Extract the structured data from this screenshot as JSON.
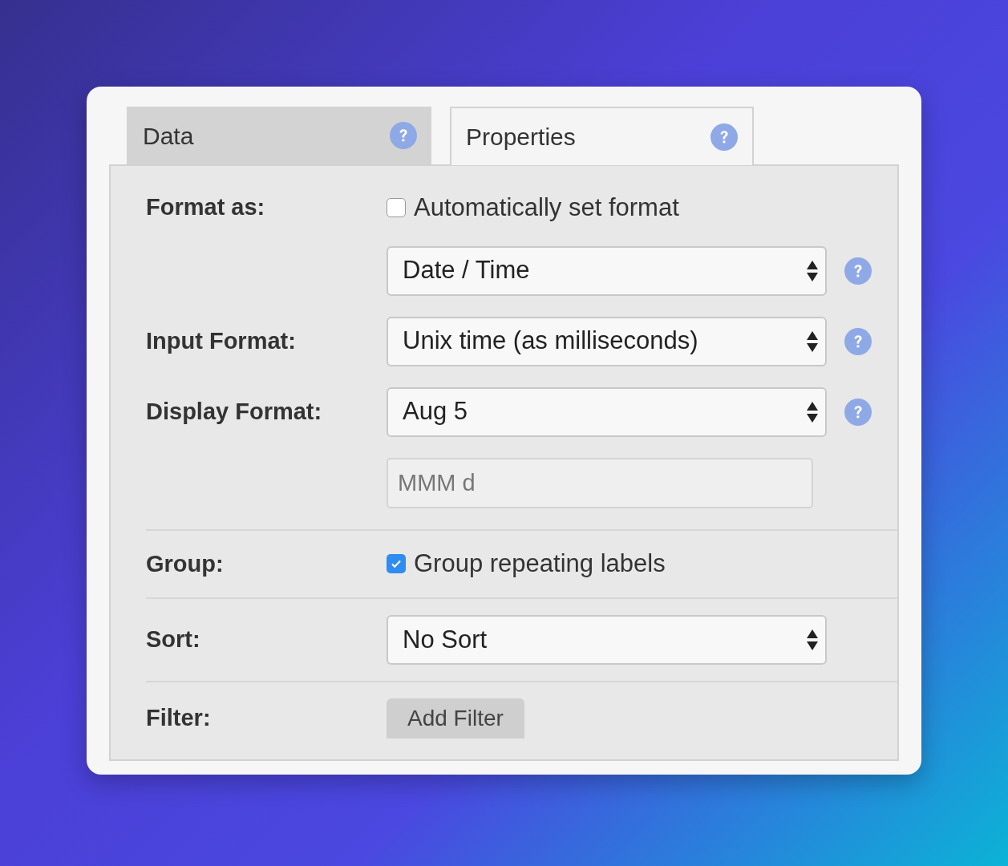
{
  "tabs": [
    {
      "label": "Data",
      "selected": false,
      "help": true
    },
    {
      "label": "Properties",
      "selected": true,
      "help": true
    }
  ],
  "sections": [
    {
      "rows": [
        {
          "label": "Format as:",
          "kind": "checkbox",
          "text": "Automatically set format",
          "checked": false
        },
        {
          "kind": "select",
          "value": "Date / Time",
          "help": true
        },
        {
          "label": "Input Format:",
          "kind": "select",
          "value": "Unix time (as milliseconds)",
          "help": true
        },
        {
          "label": "Display Format:",
          "kind": "select",
          "value": "Aug 5",
          "help": true
        },
        {
          "kind": "input",
          "placeholder": "MMM d"
        }
      ]
    },
    {
      "rows": [
        {
          "label": "Group:",
          "kind": "checkbox",
          "text": "Group repeating labels",
          "checked": true
        }
      ]
    },
    {
      "rows": [
        {
          "label": "Sort:",
          "kind": "select",
          "value": "No Sort",
          "help": false
        }
      ]
    },
    {
      "rows": [
        {
          "label": "Filter:",
          "kind": "button",
          "text": "Add Filter"
        }
      ]
    }
  ]
}
